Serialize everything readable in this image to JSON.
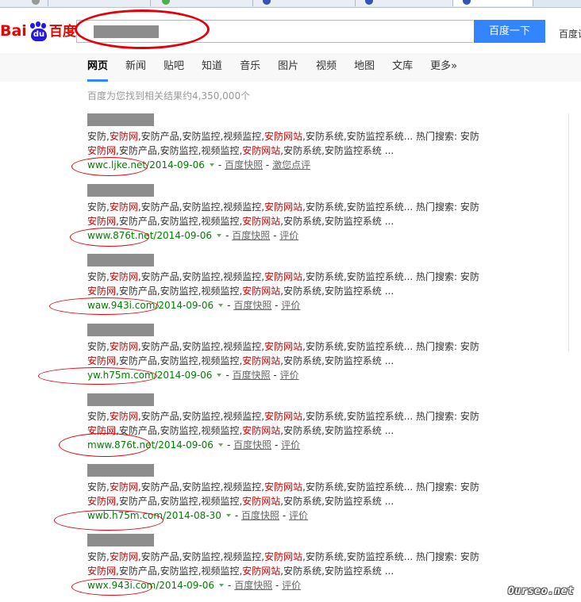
{
  "header": {
    "logo_bai": "Bai",
    "logo_du": "du",
    "logo_cn": "百度",
    "search_button": "百度一下",
    "right_link": "百度设"
  },
  "nav": {
    "tabs": [
      {
        "label": "网页",
        "active": true
      },
      {
        "label": "新闻",
        "active": false
      },
      {
        "label": "贴吧",
        "active": false
      },
      {
        "label": "知道",
        "active": false
      },
      {
        "label": "音乐",
        "active": false
      },
      {
        "label": "图片",
        "active": false
      },
      {
        "label": "视频",
        "active": false
      },
      {
        "label": "地图",
        "active": false
      },
      {
        "label": "文库",
        "active": false
      },
      {
        "label": "更多»",
        "active": false
      }
    ]
  },
  "result_count": "百度为您找到相关结果约4,350,000个",
  "results": [
    {
      "line1": [
        "安防,",
        "安防网",
        ",安防产品,安防监控,视频监控,",
        "安防网站",
        ",安防系统,安防监控系统... 热门搜索: 安防"
      ],
      "line2": [
        "",
        "安防网",
        ",安防产品,安防监控,视频监控,",
        "安防网站",
        ",安防系统,安防监控系统 ..."
      ],
      "url": "wwc.ljke.net/",
      "date": "2014-09-06",
      "snapshot": "百度快照",
      "review": "激您点评"
    },
    {
      "line1": [
        "安防,",
        "安防网",
        ",安防产品,安防监控,视频监控,",
        "安防网站",
        ",安防系统,安防监控系统... 热门搜索: 安防"
      ],
      "line2": [
        "",
        "安防网",
        ",安防产品,安防监控,视频监控,",
        "安防网站",
        ",安防系统,安防监控系统 ..."
      ],
      "url": "www.876t.net/",
      "date": "2014-09-06",
      "snapshot": "百度快照",
      "review": "评价"
    },
    {
      "line1": [
        "安防,",
        "安防网",
        ",安防产品,安防监控,视频监控,",
        "安防网站",
        ",安防系统,安防监控系统... 热门搜索: 安防"
      ],
      "line2": [
        "",
        "安防网",
        ",安防产品,安防监控,视频监控,",
        "安防网站",
        ",安防系统,安防监控系统 ..."
      ],
      "url": "waw.943i.com/",
      "date": "2014-09-06",
      "snapshot": "百度快照",
      "review": "评价"
    },
    {
      "line1": [
        "安防,",
        "安防网",
        ",安防产品,安防监控,视频监控,",
        "安防网站",
        ",安防系统,安防监控系统... 热门搜索: 安防"
      ],
      "line2": [
        "",
        "安防网",
        ",安防产品,安防监控,视频监控,",
        "安防网站",
        ",安防系统,安防监控系统 ..."
      ],
      "url": "yw.h75m.com/",
      "date": "2014-09-06",
      "snapshot": "百度快照",
      "review": "评价"
    },
    {
      "line1": [
        "安防,",
        "安防网",
        ",安防产品,安防监控,视频监控,",
        "安防网站",
        ",安防系统,安防监控系统... 热门搜索: 安防"
      ],
      "line2": [
        "",
        "安防网",
        ",安防产品,安防监控,视频监控,",
        "安防网站",
        ",安防系统,安防监控系统 ..."
      ],
      "url": "mww.876t.net/",
      "date": "2014-09-06",
      "snapshot": "百度快照",
      "review": "评价"
    },
    {
      "line1": [
        "安防,",
        "安防网",
        ",安防产品,安防监控,视频监控,",
        "安防网站",
        ",安防系统,安防监控系统... 热门搜索: 安防"
      ],
      "line2": [
        "",
        "安防网",
        ",安防产品,安防监控,视频监控,",
        "安防网站",
        ",安防系统,安防监控系统 ..."
      ],
      "url": "wwb.h75m.com/",
      "date": "2014-08-30",
      "snapshot": "百度快照",
      "review": "评价"
    },
    {
      "line1": [
        "安防,",
        "安防网",
        ",安防产品,安防监控,视频监控,",
        "安防网站",
        ",安防系统,安防监控系统... 热门搜索: 安防"
      ],
      "line2": [
        "",
        "安防网",
        ",安防产品,安防监控,视频监控,",
        "安防网站",
        ",安防系统,安防监控系统 ..."
      ],
      "url": "wwx.943i.com/",
      "date": "2014-09-06",
      "snapshot": "百度快照",
      "review": "评价"
    }
  ],
  "watermark": "Ourseo.net",
  "colors": {
    "accent": "#3385ff",
    "highlight": "#cc0000",
    "url_green": "#008000",
    "annotation_red": "#e4000b"
  }
}
